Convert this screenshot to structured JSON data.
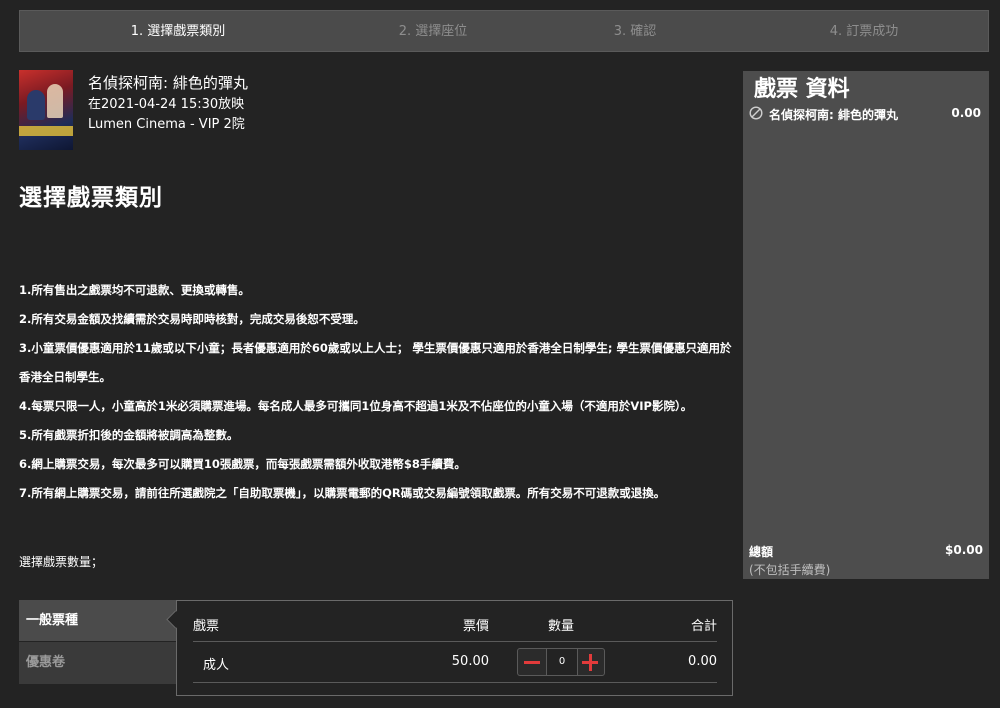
{
  "steps": [
    {
      "label": "1. 選擇戲票類別"
    },
    {
      "label": "2. 選擇座位"
    },
    {
      "label": "3. 確認"
    },
    {
      "label": "4. 訂票成功"
    }
  ],
  "movie": {
    "title": "名偵探柯南: 緋色的彈丸",
    "showtime": "在2021-04-24 15:30放映",
    "cinema": "Lumen Cinema - VIP 2院"
  },
  "section_title": "選擇戲票類別",
  "terms": [
    "1.所有售出之戲票均不可退款、更換或轉售。",
    "2.所有交易金額及找續需於交易時即時核對，完成交易後恕不受理。",
    "3.小童票價優惠適用於11歲或以下小童；長者優惠適用於60歲或以上人士； 學生票價優惠只適用於香港全日制學生; 學生票價優惠只適用於香港全日制學生。",
    "4.每票只限一人，小童高於1米必須購票進場。每名成人最多可攜同1位身高不超過1米及不佔座位的小童入場（不適用於VIP影院）。",
    "5.所有戲票折扣後的金額將被調高為整數。",
    "6.網上購票交易，每次最多可以購買10張戲票，而每張戲票需額外收取港幣$8手續費。",
    "7.所有網上購票交易，請前往所選戲院之「自助取票機」，以購票電郵的QR碼或交易編號領取戲票。所有交易不可退款或退換。"
  ],
  "quantity_label": "選擇戲票數量；",
  "sidebar": {
    "title": "戲票 資料",
    "item_name": "名偵探柯南: 緋色的彈丸",
    "item_price": "0.00",
    "total_label": "總額",
    "total_value": "$0.00",
    "fee_note": "(不包括手續費)"
  },
  "tabs": {
    "general": "一般票種",
    "coupon": "優惠卷"
  },
  "ticket_table": {
    "headers": {
      "type": "戲票",
      "price": "票價",
      "qty": "數量",
      "subtotal": "合計"
    },
    "rows": [
      {
        "type": "成人",
        "price": "50.00",
        "qty": "0",
        "subtotal": "0.00"
      }
    ]
  },
  "colors": {
    "background": "#232323",
    "step_bar": "#4b4b4b",
    "sidebar": "#4d4d4d",
    "accent_red": "#e23b3b"
  }
}
